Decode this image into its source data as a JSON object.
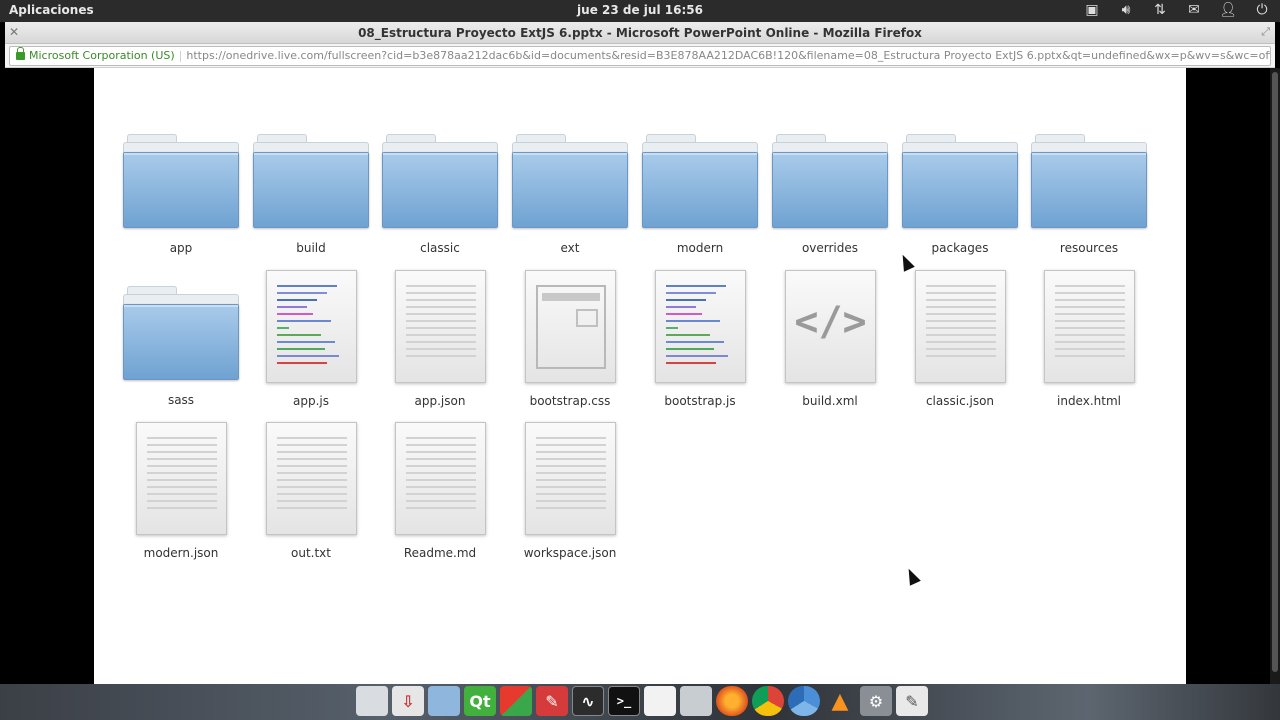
{
  "system_panel": {
    "apps_menu": "Aplicaciones",
    "clock": "jue 23 de jul 16:56",
    "tray_icons": [
      "window-icon",
      "volume-icon",
      "network-icon",
      "mail-icon",
      "user-icon",
      "power-icon"
    ]
  },
  "window": {
    "title": "08_Estructura Proyecto ExtJS 6.pptx - Microsoft PowerPoint Online - Mozilla Firefox"
  },
  "urlbar": {
    "identity": "Microsoft Corporation (US)",
    "url": "https://onedrive.live.com/fullscreen?cid=b3e878aa212dac6b&id=documents&resid=B3E878AA212DAC6B!120&filename=08_Estructura Proyecto ExtJS 6.pptx&qt=undefined&wx=p&wv=s&wc=officeapps.live.com&wy=y&wdf"
  },
  "slide": {
    "row1": [
      {
        "name": "app",
        "icon": "folder-icon"
      },
      {
        "name": "build",
        "icon": "folder-icon"
      },
      {
        "name": "classic",
        "icon": "folder-icon"
      },
      {
        "name": "ext",
        "icon": "folder-icon"
      },
      {
        "name": "modern",
        "icon": "folder-icon"
      },
      {
        "name": "overrides",
        "icon": "folder-icon"
      },
      {
        "name": "packages",
        "icon": "folder-icon"
      },
      {
        "name": "resources",
        "icon": "folder-icon"
      }
    ],
    "row2": [
      {
        "name": "sass",
        "icon": "folder-icon"
      },
      {
        "name": "app.js",
        "icon": "code-file-icon"
      },
      {
        "name": "app.json",
        "icon": "text-file-icon"
      },
      {
        "name": "bootstrap.css",
        "icon": "css-file-icon"
      },
      {
        "name": "bootstrap.js",
        "icon": "code-file-icon"
      },
      {
        "name": "build.xml",
        "icon": "xml-file-icon"
      },
      {
        "name": "classic.json",
        "icon": "text-file-icon"
      },
      {
        "name": "index.html",
        "icon": "text-file-icon"
      }
    ],
    "row3": [
      {
        "name": "modern.json",
        "icon": "text-file-icon"
      },
      {
        "name": "out.txt",
        "icon": "text-file-icon"
      },
      {
        "name": "Readme.md",
        "icon": "text-file-icon"
      },
      {
        "name": "workspace.json",
        "icon": "text-file-icon"
      }
    ]
  },
  "dock": {
    "apps": [
      "files-icon",
      "installer-icon",
      "box-icon",
      "qt-icon",
      "office-icon",
      "design-icon",
      "monitor-icon",
      "terminal-icon",
      "document-icon",
      "folder-icon",
      "firefox-icon",
      "chrome-icon",
      "chromium-icon",
      "vlc-icon",
      "settings-icon",
      "editor-icon"
    ]
  }
}
